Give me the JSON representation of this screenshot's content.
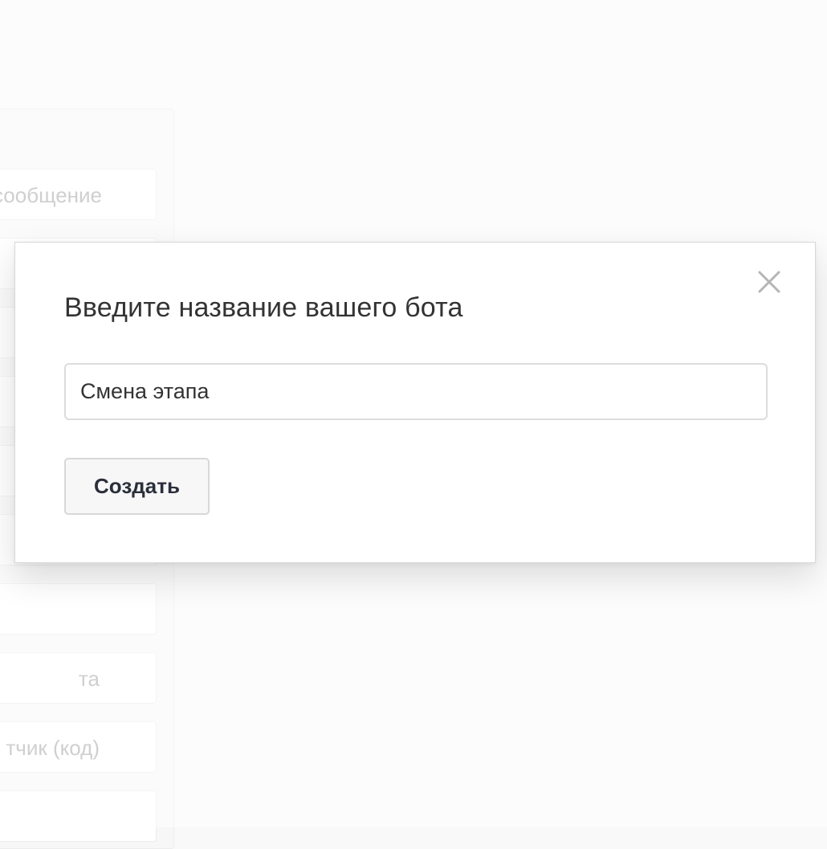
{
  "sidebar": {
    "items": [
      {
        "label": "сообщение"
      },
      {
        "label": ""
      },
      {
        "label": ""
      },
      {
        "label": ""
      },
      {
        "label": ""
      },
      {
        "label": ""
      },
      {
        "label": ""
      },
      {
        "label": "та"
      },
      {
        "label": "тчик (код)"
      },
      {
        "label": ""
      }
    ]
  },
  "modal": {
    "title": "Введите название вашего бота",
    "name_input_value": "Смена этапа",
    "create_button_label": "Создать",
    "close_icon": "close-icon"
  }
}
